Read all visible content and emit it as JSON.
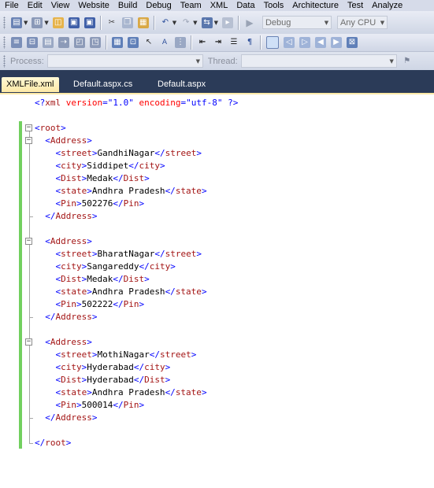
{
  "menu": [
    "File",
    "Edit",
    "View",
    "Website",
    "Build",
    "Debug",
    "Team",
    "XML",
    "Data",
    "Tools",
    "Architecture",
    "Test",
    "Analyze"
  ],
  "toolbar": {
    "configuration": "Debug",
    "platform": "Any CPU"
  },
  "debug_location": {
    "process_label": "Process:",
    "thread_label": "Thread:"
  },
  "tabs": [
    {
      "label": "XMLFile.xml",
      "active": true
    },
    {
      "label": "Default.aspx.cs",
      "active": false
    },
    {
      "label": "Default.aspx",
      "active": false
    }
  ],
  "xml_declaration": {
    "name": "xml",
    "version_attr": "version",
    "version_value": "\"1.0\"",
    "encoding_attr": "encoding",
    "encoding_value": "\"utf-8\""
  },
  "root_tag": "root",
  "address_tag": "Address",
  "addresses": [
    {
      "street": "GandhiNagar",
      "city": "Siddipet",
      "dist": "Medak",
      "state": "Andhra Pradesh",
      "pin": "502276"
    },
    {
      "street": "BharatNagar",
      "city": "Sangareddy",
      "dist": "Medak",
      "state": "Andhra Pradesh",
      "pin": "502222"
    },
    {
      "street": "MothiNagar",
      "city": "Hyderabad",
      "dist": "Hyderabad",
      "state": "Andhra Pradesh",
      "pin": "500014"
    }
  ],
  "field_tags": [
    "street",
    "city",
    "Dist",
    "state",
    "Pin"
  ],
  "colors": {
    "bracket": "#0000ff",
    "tag_name": "#a31515",
    "attribute": "#ff0000",
    "change_bar": "#72d05f",
    "tab_strip": "#2b3b58"
  }
}
